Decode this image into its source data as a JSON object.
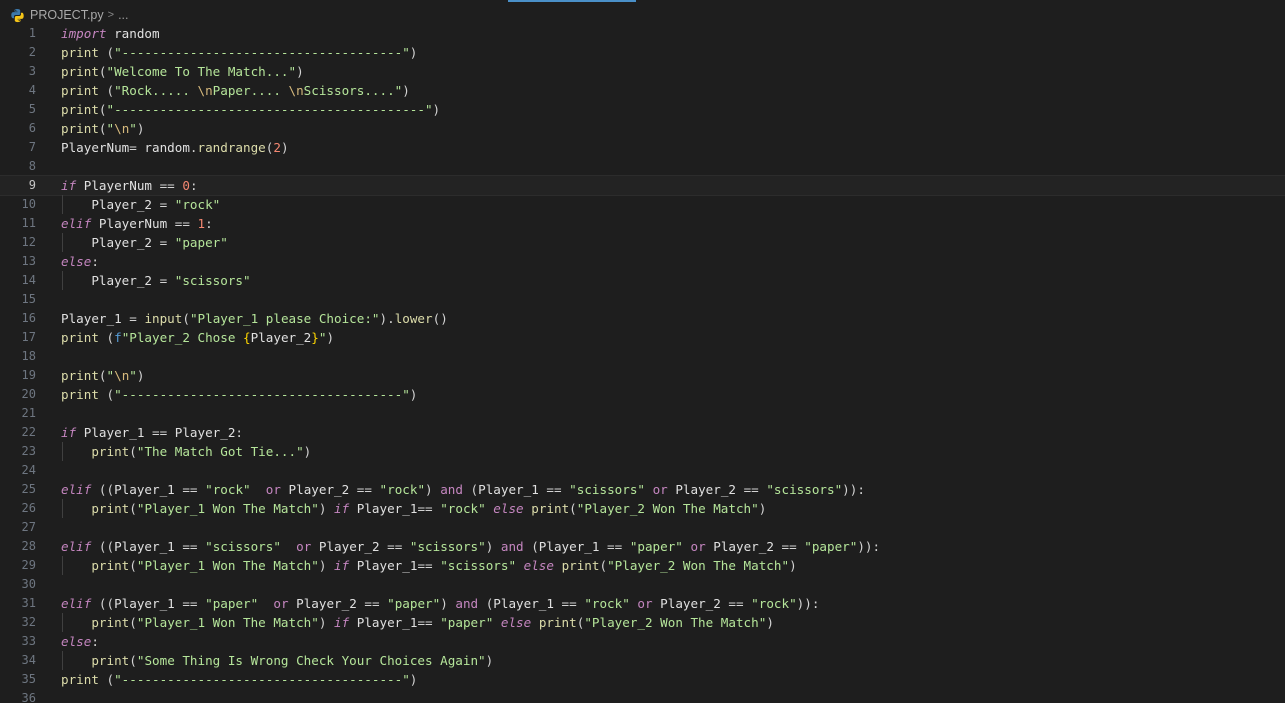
{
  "breadcrumb": {
    "file": "PROJECT.py",
    "separator": ">",
    "more": "..."
  },
  "colors": {
    "background": "#1e1e1e",
    "keyword": "#c586c0",
    "function": "#dcdcaa",
    "string": "#b5e59a",
    "number": "#f48771",
    "line_number": "#6e7681"
  },
  "editor": {
    "active_line": 9,
    "lines": [
      {
        "n": "1",
        "tokens": [
          [
            "kw",
            "import"
          ],
          [
            "var",
            " random"
          ]
        ]
      },
      {
        "n": "2",
        "tokens": [
          [
            "fn",
            "print"
          ],
          [
            "plain",
            " ("
          ],
          [
            "str2",
            "\"-------------------------------------\""
          ],
          [
            "plain",
            ")"
          ]
        ]
      },
      {
        "n": "3",
        "tokens": [
          [
            "fn",
            "print"
          ],
          [
            "plain",
            "("
          ],
          [
            "str2",
            "\"Welcome To The Match...\""
          ],
          [
            "plain",
            ")"
          ]
        ]
      },
      {
        "n": "4",
        "tokens": [
          [
            "fn",
            "print"
          ],
          [
            "plain",
            " ("
          ],
          [
            "str2",
            "\"Rock..... "
          ],
          [
            "esc",
            "\\n"
          ],
          [
            "str2",
            "Paper.... "
          ],
          [
            "esc",
            "\\n"
          ],
          [
            "str2",
            "Scissors....\""
          ],
          [
            "plain",
            ")"
          ]
        ]
      },
      {
        "n": "5",
        "tokens": [
          [
            "fn",
            "print"
          ],
          [
            "plain",
            "("
          ],
          [
            "str2",
            "\"-----------------------------------------\""
          ],
          [
            "plain",
            ")"
          ]
        ]
      },
      {
        "n": "6",
        "tokens": [
          [
            "fn",
            "print"
          ],
          [
            "plain",
            "("
          ],
          [
            "str2",
            "\""
          ],
          [
            "esc",
            "\\n"
          ],
          [
            "str2",
            "\""
          ],
          [
            "plain",
            ")"
          ]
        ]
      },
      {
        "n": "7",
        "tokens": [
          [
            "var",
            "PlayerNum"
          ],
          [
            "op",
            "= "
          ],
          [
            "var",
            "random"
          ],
          [
            "plain",
            "."
          ],
          [
            "fn",
            "randrange"
          ],
          [
            "plain",
            "("
          ],
          [
            "num",
            "2"
          ],
          [
            "plain",
            ")"
          ]
        ]
      },
      {
        "n": "8",
        "tokens": []
      },
      {
        "n": "9",
        "tokens": [
          [
            "kw",
            "if"
          ],
          [
            "var",
            " PlayerNum "
          ],
          [
            "op",
            "=="
          ],
          [
            "var",
            " "
          ],
          [
            "num",
            "0"
          ],
          [
            "plain",
            ":"
          ]
        ]
      },
      {
        "n": "10",
        "indent": true,
        "tokens": [
          [
            "var",
            "    Player_2 "
          ],
          [
            "op",
            "="
          ],
          [
            "var",
            " "
          ],
          [
            "str2",
            "\"rock\""
          ]
        ]
      },
      {
        "n": "11",
        "tokens": [
          [
            "kw",
            "elif"
          ],
          [
            "var",
            " PlayerNum "
          ],
          [
            "op",
            "=="
          ],
          [
            "var",
            " "
          ],
          [
            "num",
            "1"
          ],
          [
            "plain",
            ":"
          ]
        ]
      },
      {
        "n": "12",
        "indent": true,
        "tokens": [
          [
            "var",
            "    Player_2 "
          ],
          [
            "op",
            "="
          ],
          [
            "var",
            " "
          ],
          [
            "str2",
            "\"paper\""
          ]
        ]
      },
      {
        "n": "13",
        "tokens": [
          [
            "kw",
            "else"
          ],
          [
            "plain",
            ":"
          ]
        ]
      },
      {
        "n": "14",
        "indent": true,
        "tokens": [
          [
            "var",
            "    Player_2 "
          ],
          [
            "op",
            "="
          ],
          [
            "var",
            " "
          ],
          [
            "str2",
            "\"scissors\""
          ]
        ]
      },
      {
        "n": "15",
        "tokens": []
      },
      {
        "n": "16",
        "tokens": [
          [
            "var",
            "Player_1 "
          ],
          [
            "op",
            "="
          ],
          [
            "var",
            " "
          ],
          [
            "fn",
            "input"
          ],
          [
            "plain",
            "("
          ],
          [
            "str2",
            "\"Player_1 please Choice:\""
          ],
          [
            "plain",
            ")."
          ],
          [
            "fn",
            "lower"
          ],
          [
            "plain",
            "()"
          ]
        ]
      },
      {
        "n": "17",
        "tokens": [
          [
            "fn",
            "print"
          ],
          [
            "plain",
            " ("
          ],
          [
            "fstr",
            "f"
          ],
          [
            "str2",
            "\"Player_2 Chose "
          ],
          [
            "gold",
            "{"
          ],
          [
            "var",
            "Player_2"
          ],
          [
            "gold",
            "}"
          ],
          [
            "str2",
            "\""
          ],
          [
            "plain",
            ")"
          ]
        ]
      },
      {
        "n": "18",
        "tokens": []
      },
      {
        "n": "19",
        "tokens": [
          [
            "fn",
            "print"
          ],
          [
            "plain",
            "("
          ],
          [
            "str2",
            "\""
          ],
          [
            "esc",
            "\\n"
          ],
          [
            "str2",
            "\""
          ],
          [
            "plain",
            ")"
          ]
        ]
      },
      {
        "n": "20",
        "tokens": [
          [
            "fn",
            "print"
          ],
          [
            "plain",
            " ("
          ],
          [
            "str2",
            "\"-------------------------------------\""
          ],
          [
            "plain",
            ")"
          ]
        ]
      },
      {
        "n": "21",
        "tokens": []
      },
      {
        "n": "22",
        "tokens": [
          [
            "kw",
            "if"
          ],
          [
            "var",
            " Player_1 "
          ],
          [
            "op",
            "=="
          ],
          [
            "var",
            " Player_2"
          ],
          [
            "plain",
            ":"
          ]
        ]
      },
      {
        "n": "23",
        "indent": true,
        "tokens": [
          [
            "var",
            "    "
          ],
          [
            "fn",
            "print"
          ],
          [
            "plain",
            "("
          ],
          [
            "str2",
            "\"The Match Got Tie...\""
          ],
          [
            "plain",
            ")"
          ]
        ]
      },
      {
        "n": "24",
        "tokens": []
      },
      {
        "n": "25",
        "tokens": [
          [
            "kw",
            "elif"
          ],
          [
            "plain",
            " (("
          ],
          [
            "var",
            "Player_1 "
          ],
          [
            "op",
            "=="
          ],
          [
            "var",
            " "
          ],
          [
            "str2",
            "\"rock\""
          ],
          [
            "var",
            "  "
          ],
          [
            "opkw",
            "or"
          ],
          [
            "var",
            " Player_2 "
          ],
          [
            "op",
            "=="
          ],
          [
            "var",
            " "
          ],
          [
            "str2",
            "\"rock\""
          ],
          [
            "plain",
            ") "
          ],
          [
            "opkw",
            "and"
          ],
          [
            "plain",
            " ("
          ],
          [
            "var",
            "Player_1 "
          ],
          [
            "op",
            "=="
          ],
          [
            "var",
            " "
          ],
          [
            "str2",
            "\"scissors\""
          ],
          [
            "var",
            " "
          ],
          [
            "opkw",
            "or"
          ],
          [
            "var",
            " Player_2 "
          ],
          [
            "op",
            "=="
          ],
          [
            "var",
            " "
          ],
          [
            "str2",
            "\"scissors\""
          ],
          [
            "plain",
            "))"
          ],
          [
            "plain",
            ":"
          ]
        ]
      },
      {
        "n": "26",
        "indent": true,
        "tokens": [
          [
            "var",
            "    "
          ],
          [
            "fn",
            "print"
          ],
          [
            "plain",
            "("
          ],
          [
            "str2",
            "\"Player_1 Won The Match\""
          ],
          [
            "plain",
            ") "
          ],
          [
            "kw",
            "if"
          ],
          [
            "var",
            " Player_1"
          ],
          [
            "op",
            "=="
          ],
          [
            "var",
            " "
          ],
          [
            "str2",
            "\"rock\""
          ],
          [
            "var",
            " "
          ],
          [
            "kw",
            "else"
          ],
          [
            "var",
            " "
          ],
          [
            "fn",
            "print"
          ],
          [
            "plain",
            "("
          ],
          [
            "str2",
            "\"Player_2 Won The Match\""
          ],
          [
            "plain",
            ")"
          ]
        ]
      },
      {
        "n": "27",
        "tokens": []
      },
      {
        "n": "28",
        "tokens": [
          [
            "kw",
            "elif"
          ],
          [
            "plain",
            " (("
          ],
          [
            "var",
            "Player_1 "
          ],
          [
            "op",
            "=="
          ],
          [
            "var",
            " "
          ],
          [
            "str2",
            "\"scissors\""
          ],
          [
            "var",
            "  "
          ],
          [
            "opkw",
            "or"
          ],
          [
            "var",
            " Player_2 "
          ],
          [
            "op",
            "=="
          ],
          [
            "var",
            " "
          ],
          [
            "str2",
            "\"scissors\""
          ],
          [
            "plain",
            ") "
          ],
          [
            "opkw",
            "and"
          ],
          [
            "plain",
            " ("
          ],
          [
            "var",
            "Player_1 "
          ],
          [
            "op",
            "=="
          ],
          [
            "var",
            " "
          ],
          [
            "str2",
            "\"paper\""
          ],
          [
            "var",
            " "
          ],
          [
            "opkw",
            "or"
          ],
          [
            "var",
            " Player_2 "
          ],
          [
            "op",
            "=="
          ],
          [
            "var",
            " "
          ],
          [
            "str2",
            "\"paper\""
          ],
          [
            "plain",
            "))"
          ],
          [
            "plain",
            ":"
          ]
        ]
      },
      {
        "n": "29",
        "indent": true,
        "tokens": [
          [
            "var",
            "    "
          ],
          [
            "fn",
            "print"
          ],
          [
            "plain",
            "("
          ],
          [
            "str2",
            "\"Player_1 Won The Match\""
          ],
          [
            "plain",
            ") "
          ],
          [
            "kw",
            "if"
          ],
          [
            "var",
            " Player_1"
          ],
          [
            "op",
            "=="
          ],
          [
            "var",
            " "
          ],
          [
            "str2",
            "\"scissors\""
          ],
          [
            "var",
            " "
          ],
          [
            "kw",
            "else"
          ],
          [
            "var",
            " "
          ],
          [
            "fn",
            "print"
          ],
          [
            "plain",
            "("
          ],
          [
            "str2",
            "\"Player_2 Won The Match\""
          ],
          [
            "plain",
            ")"
          ]
        ]
      },
      {
        "n": "30",
        "tokens": []
      },
      {
        "n": "31",
        "tokens": [
          [
            "kw",
            "elif"
          ],
          [
            "plain",
            " (("
          ],
          [
            "var",
            "Player_1 "
          ],
          [
            "op",
            "=="
          ],
          [
            "var",
            " "
          ],
          [
            "str2",
            "\"paper\""
          ],
          [
            "var",
            "  "
          ],
          [
            "opkw",
            "or"
          ],
          [
            "var",
            " Player_2 "
          ],
          [
            "op",
            "=="
          ],
          [
            "var",
            " "
          ],
          [
            "str2",
            "\"paper\""
          ],
          [
            "plain",
            ") "
          ],
          [
            "opkw",
            "and"
          ],
          [
            "plain",
            " ("
          ],
          [
            "var",
            "Player_1 "
          ],
          [
            "op",
            "=="
          ],
          [
            "var",
            " "
          ],
          [
            "str2",
            "\"rock\""
          ],
          [
            "var",
            " "
          ],
          [
            "opkw",
            "or"
          ],
          [
            "var",
            " Player_2 "
          ],
          [
            "op",
            "=="
          ],
          [
            "var",
            " "
          ],
          [
            "str2",
            "\"rock\""
          ],
          [
            "plain",
            "))"
          ],
          [
            "plain",
            ":"
          ]
        ]
      },
      {
        "n": "32",
        "indent": true,
        "tokens": [
          [
            "var",
            "    "
          ],
          [
            "fn",
            "print"
          ],
          [
            "plain",
            "("
          ],
          [
            "str2",
            "\"Player_1 Won The Match\""
          ],
          [
            "plain",
            ") "
          ],
          [
            "kw",
            "if"
          ],
          [
            "var",
            " Player_1"
          ],
          [
            "op",
            "=="
          ],
          [
            "var",
            " "
          ],
          [
            "str2",
            "\"paper\""
          ],
          [
            "var",
            " "
          ],
          [
            "kw",
            "else"
          ],
          [
            "var",
            " "
          ],
          [
            "fn",
            "print"
          ],
          [
            "plain",
            "("
          ],
          [
            "str2",
            "\"Player_2 Won The Match\""
          ],
          [
            "plain",
            ")"
          ]
        ]
      },
      {
        "n": "33",
        "tokens": [
          [
            "kw",
            "else"
          ],
          [
            "plain",
            ":"
          ]
        ]
      },
      {
        "n": "34",
        "indent": true,
        "tokens": [
          [
            "var",
            "    "
          ],
          [
            "fn",
            "print"
          ],
          [
            "plain",
            "("
          ],
          [
            "str2",
            "\"Some Thing Is Wrong Check Your Choices Again\""
          ],
          [
            "plain",
            ")"
          ]
        ]
      },
      {
        "n": "35",
        "tokens": [
          [
            "fn",
            "print"
          ],
          [
            "plain",
            " ("
          ],
          [
            "str2",
            "\"-------------------------------------\""
          ],
          [
            "plain",
            ")"
          ]
        ]
      },
      {
        "n": "36",
        "tokens": []
      }
    ]
  }
}
